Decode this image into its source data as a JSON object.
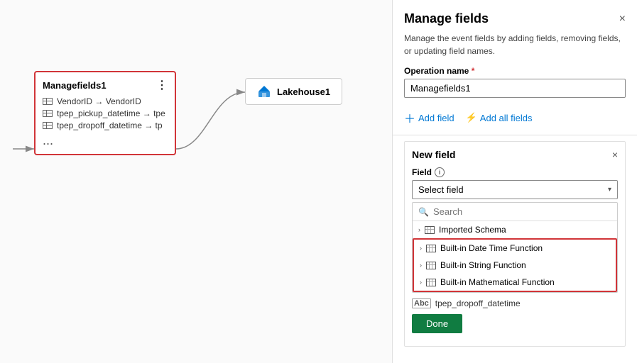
{
  "canvas": {
    "managefields_node": {
      "title": "Managefields1",
      "rows": [
        {
          "from": "VendorID",
          "to": "VendorID"
        },
        {
          "from": "tpep_pickup_datetime",
          "to": "tpe"
        },
        {
          "from": "tpep_dropoff_datetime",
          "to": "tp"
        }
      ],
      "more_label": "..."
    },
    "lakehouse_node": {
      "title": "Lakehouse1"
    }
  },
  "panel": {
    "title": "Manage fields",
    "close_label": "×",
    "description": "Manage the event fields by adding fields, removing fields, or updating field names.",
    "operation_label": "Operation name",
    "operation_value": "Managefields1",
    "add_field_label": "Add field",
    "add_all_fields_label": "Add all fields",
    "new_field": {
      "title": "New field",
      "close_label": "×",
      "field_label": "Field",
      "select_placeholder": "Select field",
      "search_placeholder": "Search",
      "dropdown_items": [
        {
          "label": "Imported Schema",
          "indent": false,
          "highlighted": false
        },
        {
          "label": "Built-in Date Time Function",
          "indent": false,
          "highlighted": true
        },
        {
          "label": "Built-in String Function",
          "indent": false,
          "highlighted": true
        },
        {
          "label": "Built-in Mathematical Function",
          "indent": false,
          "highlighted": true
        }
      ],
      "bottom_field": "tpep_dropoff_datetime",
      "done_label": "Done"
    }
  }
}
